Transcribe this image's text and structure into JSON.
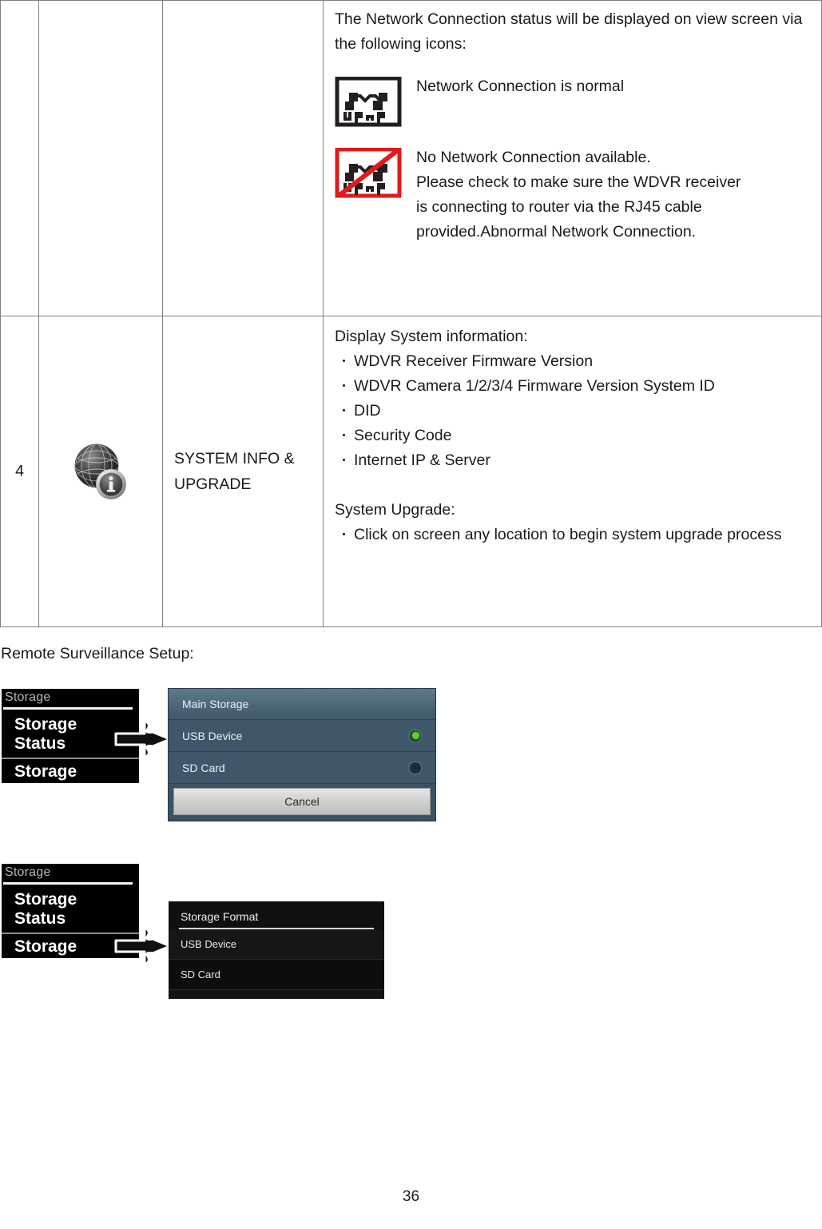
{
  "table": {
    "row_network": {
      "description_intro": "The Network Connection status will be displayed on view screen via the following icons:",
      "icon_normal": {
        "icon_name": "upnp-connected-icon",
        "icon_label": "UPnP",
        "caption": "Network Connection is normal"
      },
      "icon_error": {
        "icon_name": "upnp-disconnected-icon",
        "icon_label": "UPnP",
        "caption_line1": "No Network Connection available.",
        "caption_line2": "Please check to make sure the WDVR receiver",
        "caption_line3": "is connecting to router via the RJ45 cable",
        "caption_line4": "provided.Abnormal Network Connection.",
        "slash_color": "#e01b1b"
      }
    },
    "row_system": {
      "number": "4",
      "icon_name": "globe-info-icon",
      "name": "SYSTEM INFO & UPGRADE",
      "name_line1": "SYSTEM INFO &",
      "name_line2": "UPGRADE",
      "desc_heading_1": "Display System information:",
      "desc_items_1": [
        "WDVR Receiver Firmware Version",
        "WDVR Camera 1/2/3/4 Firmware Version System ID",
        "DID",
        "Security Code",
        "Internet IP & Server"
      ],
      "desc_heading_2": "System Upgrade:",
      "desc_items_2": [
        "Click on screen any location to begin system upgrade process"
      ],
      "bullet_char": "・"
    }
  },
  "body": {
    "caption_remote_setup": "Remote Surveillance Setup:"
  },
  "figure_main_storage": {
    "menu": {
      "title": "Storage",
      "item_1_line1": "Storage",
      "item_1_line2": "Status",
      "item_2": "Storage"
    },
    "arrow_icon": "right-arrow-icon",
    "dialog": {
      "title": "Main Storage",
      "options": [
        {
          "label": "USB Device",
          "selected": true
        },
        {
          "label": "SD Card",
          "selected": false
        }
      ],
      "cancel_label": "Cancel",
      "selected_color": "#5ed022"
    }
  },
  "figure_storage_format": {
    "menu": {
      "title": "Storage",
      "item_1_line1": "Storage",
      "item_1_line2": "Status",
      "item_2": "Storage"
    },
    "arrow_icon": "right-arrow-icon",
    "dialog": {
      "title": "Storage Format",
      "options": [
        {
          "label": "USB Device"
        },
        {
          "label": "SD Card"
        }
      ]
    }
  },
  "footer": {
    "page_number": "36"
  }
}
